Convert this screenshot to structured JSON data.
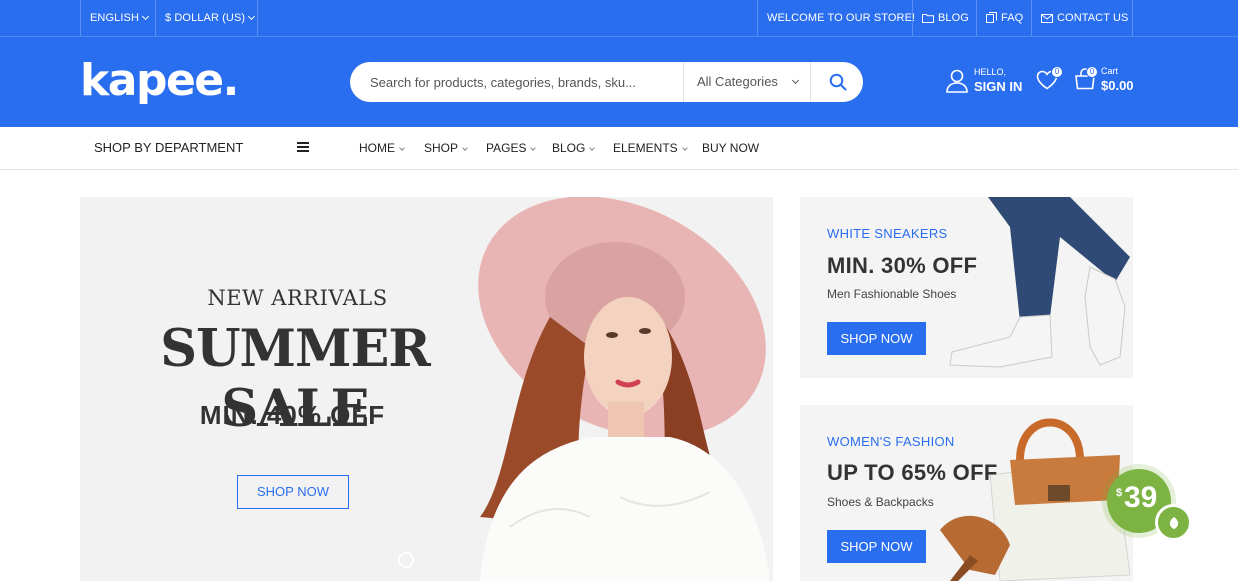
{
  "topbar": {
    "language": "ENGLISH",
    "currency": "$ DOLLAR (US)",
    "welcome": "WELCOME TO OUR STORE!",
    "blog": "BLOG",
    "faq": "FAQ",
    "contact": "CONTACT US"
  },
  "header": {
    "logo": "kapee.",
    "search_placeholder": "Search for products, categories, brands, sku...",
    "category_select": "All Categories",
    "account_greeting": "HELLO,",
    "account_action": "SIGN IN",
    "wishlist_count": "0",
    "cart_count": "0",
    "cart_label": "Cart",
    "cart_total": "$0.00"
  },
  "nav": {
    "department": "SHOP BY DEPARTMENT",
    "items": [
      "HOME",
      "SHOP",
      "PAGES",
      "BLOG",
      "ELEMENTS",
      "BUY NOW"
    ]
  },
  "hero": {
    "eyebrow": "NEW ARRIVALS",
    "title": "SUMMER SALE",
    "subtitle": "MIN. 40% OFF",
    "button": "SHOP NOW"
  },
  "promos": [
    {
      "eyebrow": "WHITE SNEAKERS",
      "title": "MIN. 30% OFF",
      "subtitle": "Men Fashionable Shoes",
      "button": "SHOP NOW"
    },
    {
      "eyebrow": "WOMEN'S FASHION",
      "title": "UP TO 65% OFF",
      "subtitle": "Shoes & Backpacks",
      "button": "SHOP NOW"
    }
  ],
  "price_badge": {
    "currency": "$",
    "value": "39"
  },
  "colors": {
    "brand": "#2a6ef0",
    "badge": "#7cb342",
    "hero_bg": "#f2f2f2",
    "promo_bg": "#f4f4f4"
  },
  "icons": [
    "folder-icon",
    "faq-icon",
    "envelope-icon",
    "search-icon",
    "user-icon",
    "heart-icon",
    "cart-icon",
    "menu-icon",
    "leaf-icon"
  ]
}
